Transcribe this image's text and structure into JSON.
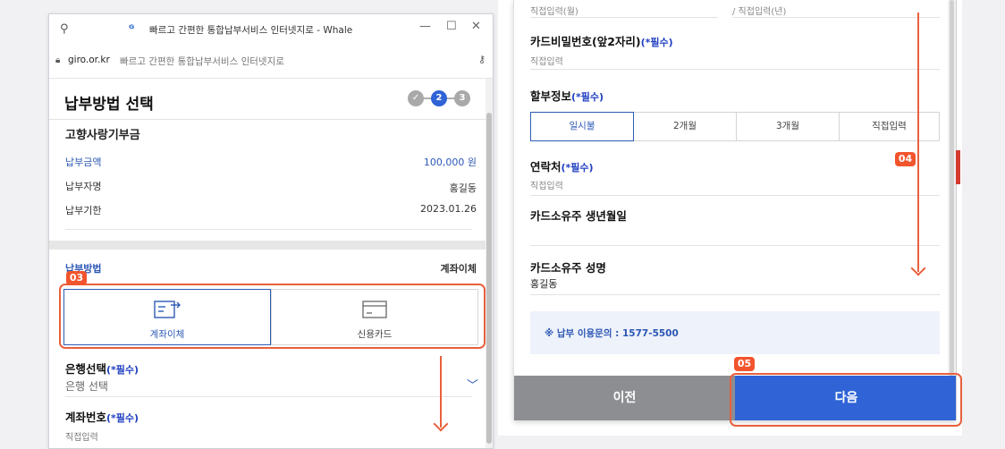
{
  "browser": {
    "title": "빠르고 간편한 통합납부서비스 인터넷지로 - Whale",
    "url": "giro.or.kr",
    "url_page_title": "빠르고 간편한 통합납부서비스 인터넷지로",
    "minimize": "—",
    "maximize": "☐",
    "close": "✕"
  },
  "left": {
    "page_title": "납부방법 선택",
    "steps": [
      "✓",
      "2",
      "3"
    ],
    "product": "고향사랑기부금",
    "amount_label": "납부금액",
    "amount_value": "100,000 원",
    "payer_label": "납부자명",
    "payer_value": "홍길동",
    "deadline_label": "납부기한",
    "deadline_value": "2023.01.26",
    "method_label": "납부방법",
    "method_value": "계좌이체",
    "pay_options": [
      "계좌이체",
      "신용카드"
    ],
    "bank_label": "은행선택",
    "required": "(*필수)",
    "bank_placeholder": "은행 선택",
    "account_label": "계좌번호",
    "account_placeholder": "직접입력"
  },
  "right": {
    "month_hint": "직접입력(월)",
    "year_hint": "/ 직접입력(년)",
    "card_pw_label": "카드비밀번호(앞2자리)",
    "required": "(*필수)",
    "card_pw_placeholder": "직접입력",
    "installment_label": "할부정보",
    "installments": [
      "일시불",
      "2개월",
      "3개월",
      "직접입력"
    ],
    "contact_label": "연락처",
    "contact_placeholder": "직접입력",
    "owner_birth_label": "카드소유주 생년월일",
    "owner_name_label": "카드소유주 성명",
    "owner_name_value": "홍길동",
    "inquiry": "※ 납부 이용문의 : 1577-5500",
    "prev_button": "이전",
    "next_button": "다음"
  },
  "annotations": {
    "tag_03": "03",
    "tag_04": "04",
    "tag_05": "05"
  },
  "colors": {
    "accent": "#2f63d6",
    "annotation": "#f2542d",
    "required": "#1f3fc0"
  }
}
